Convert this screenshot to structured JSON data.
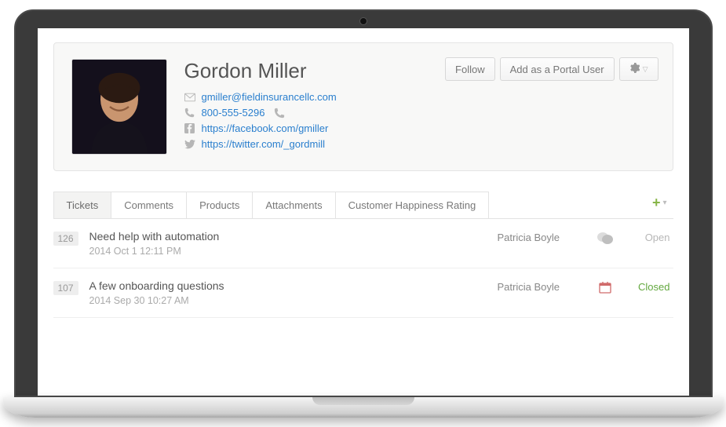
{
  "profile": {
    "name": "Gordon Miller",
    "email": "gmiller@fieldinsurancellc.com",
    "phone": "800-555-5296",
    "facebook": "https://facebook.com/gmiller",
    "twitter": "https://twitter.com/_gordmill"
  },
  "actions": {
    "follow": "Follow",
    "add_portal": "Add as a Portal User"
  },
  "tabs": [
    "Tickets",
    "Comments",
    "Products",
    "Attachments",
    "Customer Happiness Rating"
  ],
  "active_tab": 0,
  "tickets": [
    {
      "id": "126",
      "title": "Need help with automation",
      "date": "2014 Oct 1 12:11 PM",
      "assignee": "Patricia Boyle",
      "status": "Open",
      "status_class": "open",
      "icon": "chat"
    },
    {
      "id": "107",
      "title": "A few onboarding questions",
      "date": "2014 Sep 30 10:27 AM",
      "assignee": "Patricia Boyle",
      "status": "Closed",
      "status_class": "closed",
      "icon": "calendar"
    }
  ]
}
